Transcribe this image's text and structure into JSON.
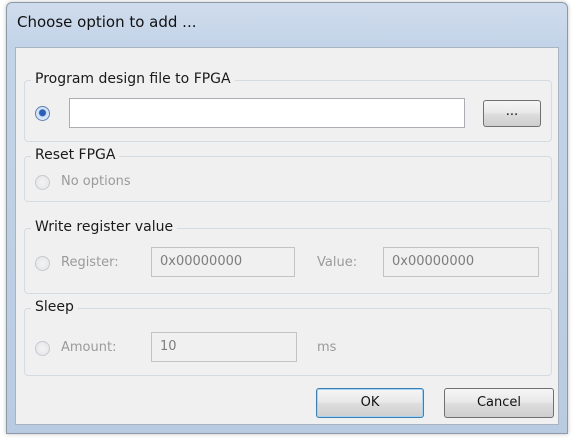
{
  "window": {
    "title": "Choose option to add ..."
  },
  "program": {
    "group_label": "Program design file to FPGA",
    "file_value": "",
    "browse_label": "..."
  },
  "reset": {
    "group_label": "Reset FPGA",
    "option_label": "No options"
  },
  "write_register": {
    "group_label": "Write register value",
    "register_label": "Register:",
    "register_value": "0x00000000",
    "value_label": "Value:",
    "value_value": "0x00000000"
  },
  "sleep": {
    "group_label": "Sleep",
    "amount_label": "Amount:",
    "amount_value": "10",
    "unit": "ms"
  },
  "buttons": {
    "ok": "OK",
    "cancel": "Cancel"
  },
  "icons": {
    "radio_checked": "radio-selected",
    "radio_unchecked": "radio-unselected"
  },
  "colors": {
    "titlebar": "#c4d4e8",
    "client_background": "#f0f0f0",
    "radio_selected": "#2c5fb7",
    "disabled_text": "#9a9a9a"
  }
}
